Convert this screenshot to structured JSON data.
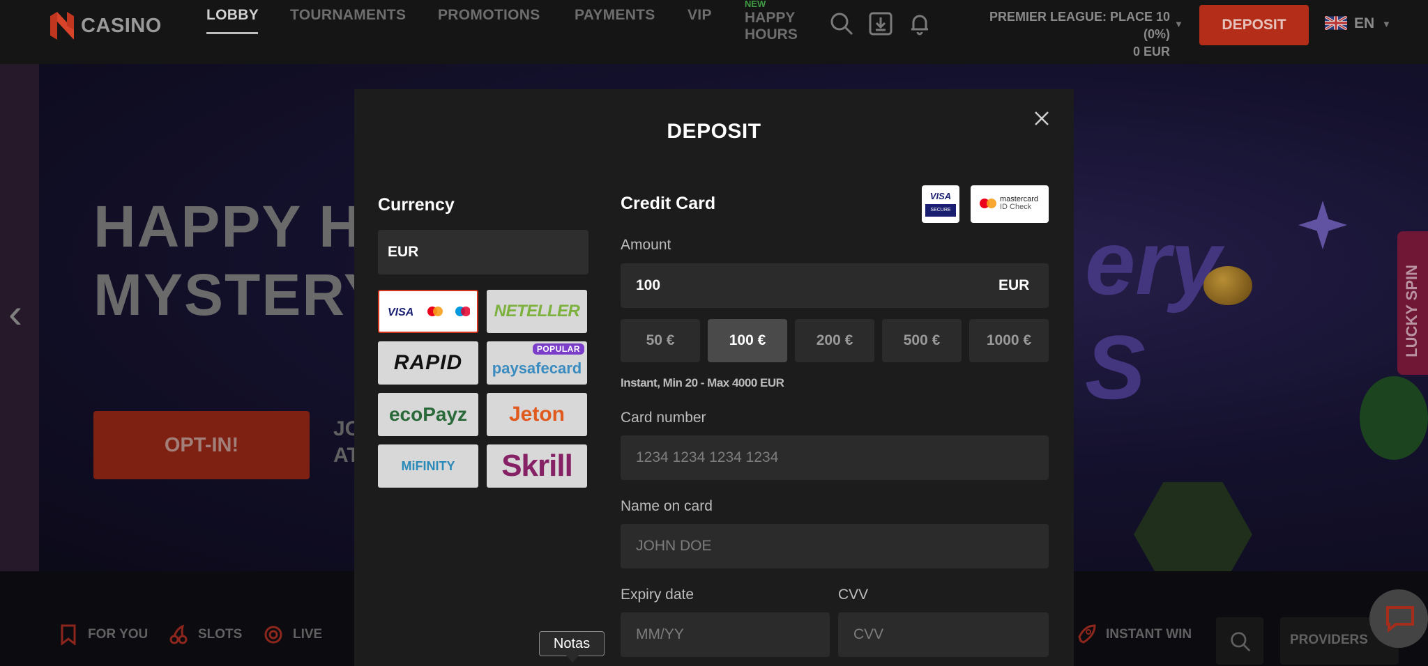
{
  "header": {
    "brand": "CASINO",
    "nav": [
      {
        "label": "LOBBY",
        "active": true
      },
      {
        "label": "TOURNAMENTS"
      },
      {
        "label": "PROMOTIONS"
      },
      {
        "label": "PAYMENTS"
      },
      {
        "label": "VIP"
      }
    ],
    "happy_hours": {
      "badge": "NEW",
      "label": "HAPPY HOURS"
    },
    "league": {
      "line1": "PREMIER LEAGUE: PLACE 10 (0%)",
      "line2": "0 EUR"
    },
    "deposit_label": "DEPOSIT",
    "language": "EN"
  },
  "hero": {
    "title": "HAPPY HO\nMYSTERY",
    "cta_label": "OPT-IN!",
    "sub": "JO\nAT",
    "bg_text": "ery\nS",
    "side_tab": "LUCKY SPIN"
  },
  "categories": [
    {
      "label": "FOR YOU"
    },
    {
      "label": "SLOTS"
    },
    {
      "label": "LIVE"
    }
  ],
  "categories_right": {
    "instant_win": "INSTANT WIN",
    "providers": "PROVIDERS"
  },
  "modal": {
    "title": "DEPOSIT",
    "currency_label": "Currency",
    "currency_value": "EUR",
    "payment_methods": [
      {
        "id": "cards",
        "selected": true
      },
      {
        "id": "neteller",
        "label": "NETELLER"
      },
      {
        "id": "rapid",
        "label": "RAPID"
      },
      {
        "id": "paysafecard",
        "label": "paysafecard",
        "badge": "POPULAR"
      },
      {
        "id": "ecopayz",
        "label": "ecoPayz"
      },
      {
        "id": "jeton",
        "label": "Jeton"
      },
      {
        "id": "mifinity",
        "label": "MiFINITY"
      },
      {
        "id": "skrill",
        "label": "Skrill"
      }
    ],
    "card_logos": {
      "visa": "VISA",
      "visa_sub": "SECURE",
      "mc": "mastercard",
      "mc_sub": "ID Check"
    },
    "pm_logo_text": {
      "visa": "VISA"
    },
    "method_title": "Credit Card",
    "amount_label": "Amount",
    "amount_value": "100",
    "amount_currency": "EUR",
    "presets": [
      {
        "label": "50 €"
      },
      {
        "label": "100 €",
        "active": true
      },
      {
        "label": "200 €"
      },
      {
        "label": "500 €"
      },
      {
        "label": "1000 €"
      }
    ],
    "limits": "Instant, Min 20 - Max 4000 EUR",
    "card_number_label": "Card number",
    "card_number_placeholder": "1234 1234 1234 1234",
    "name_label": "Name on card",
    "name_placeholder": "JOHN DOE",
    "expiry_label": "Expiry date",
    "expiry_placeholder": "MM/YY",
    "cvv_label": "CVV",
    "cvv_placeholder": "CVV"
  },
  "tooltip": "Notas",
  "colors": {
    "accent": "#d3351f",
    "deposit_button": "#b32d18",
    "modal_bg": "#1c1c1c",
    "field_bg": "#2b2b2b",
    "popular_badge": "#7b3ecb"
  }
}
